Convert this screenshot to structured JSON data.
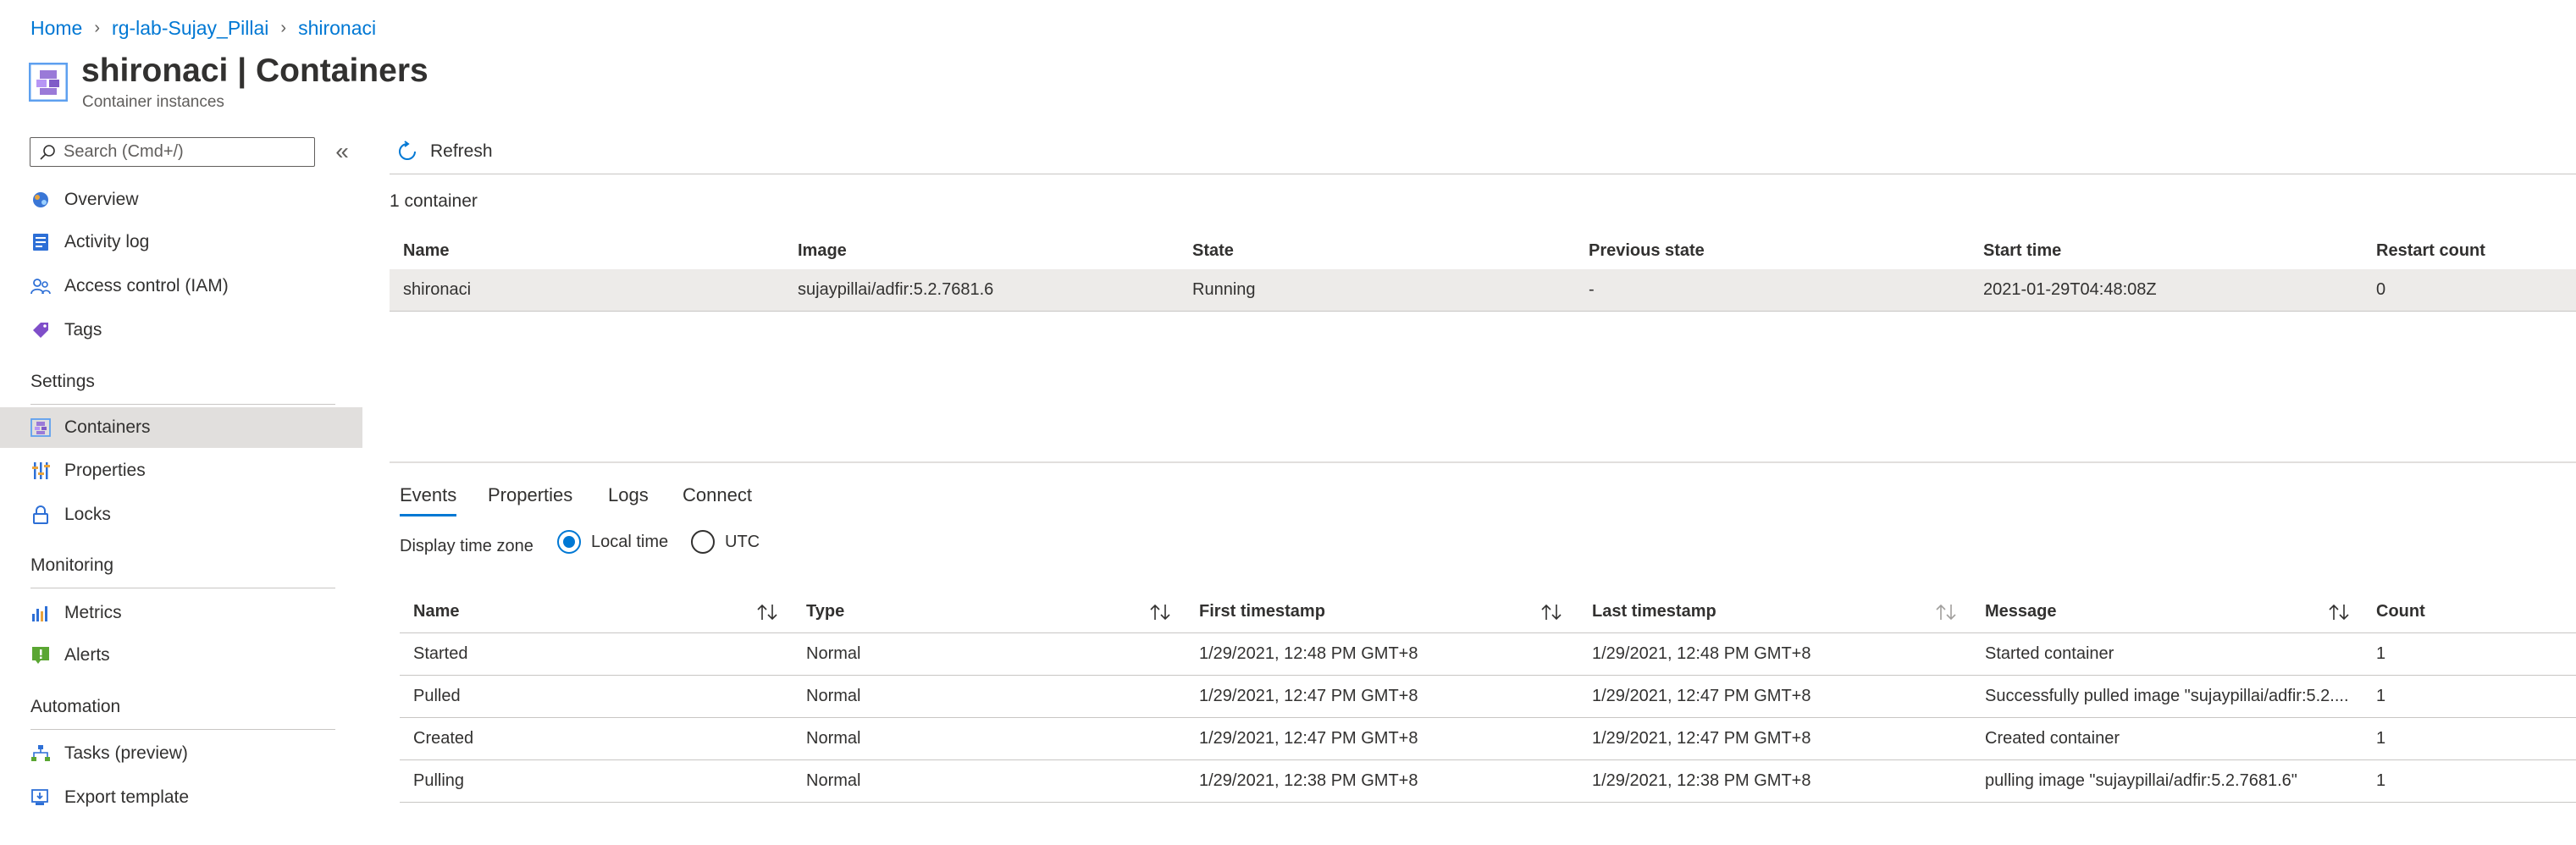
{
  "breadcrumb": {
    "home": "Home",
    "resource_group": "rg-lab-Sujay_Pillai",
    "resource": "shironaci"
  },
  "header": {
    "name": "shironaci",
    "separator": " | ",
    "section": "Containers",
    "subtitle": "Container instances"
  },
  "sidebar": {
    "search_placeholder": "Search (Cmd+/)",
    "collapse_glyph": "«",
    "items_top": [
      {
        "label": "Overview",
        "icon": "overview-icon"
      },
      {
        "label": "Activity log",
        "icon": "activity-log-icon"
      },
      {
        "label": "Access control (IAM)",
        "icon": "access-control-icon"
      },
      {
        "label": "Tags",
        "icon": "tag-icon"
      }
    ],
    "settings_header": "Settings",
    "settings_items": [
      {
        "label": "Containers",
        "icon": "containers-icon",
        "selected": true
      },
      {
        "label": "Properties",
        "icon": "properties-icon"
      },
      {
        "label": "Locks",
        "icon": "lock-icon"
      }
    ],
    "monitoring_header": "Monitoring",
    "monitoring_items": [
      {
        "label": "Metrics",
        "icon": "metrics-icon"
      },
      {
        "label": "Alerts",
        "icon": "alerts-icon"
      }
    ],
    "automation_header": "Automation",
    "automation_items": [
      {
        "label": "Tasks (preview)",
        "icon": "tasks-icon"
      },
      {
        "label": "Export template",
        "icon": "export-template-icon"
      }
    ]
  },
  "toolbar": {
    "refresh_label": "Refresh"
  },
  "containers": {
    "count_label": "1 container",
    "columns": [
      "Name",
      "Image",
      "State",
      "Previous state",
      "Start time",
      "Restart count"
    ],
    "rows": [
      {
        "name": "shironaci",
        "image": "sujaypillai/adfir:5.2.7681.6",
        "state": "Running",
        "previous_state": "-",
        "start_time": "2021-01-29T04:48:08Z",
        "restart_count": "0"
      }
    ]
  },
  "tabs": [
    "Events",
    "Properties",
    "Logs",
    "Connect"
  ],
  "timezone": {
    "label": "Display time zone",
    "options": [
      "Local time",
      "UTC"
    ],
    "selected": "Local time"
  },
  "events": {
    "columns": [
      "Name",
      "Type",
      "First timestamp",
      "Last timestamp",
      "Message",
      "Count"
    ],
    "rows": [
      {
        "name": "Started",
        "type": "Normal",
        "first": "1/29/2021, 12:48 PM GMT+8",
        "last": "1/29/2021, 12:48 PM GMT+8",
        "message": "Started container",
        "count": "1"
      },
      {
        "name": "Pulled",
        "type": "Normal",
        "first": "1/29/2021, 12:47 PM GMT+8",
        "last": "1/29/2021, 12:47 PM GMT+8",
        "message": "Successfully pulled image \"sujaypillai/adfir:5.2....",
        "count": "1"
      },
      {
        "name": "Created",
        "type": "Normal",
        "first": "1/29/2021, 12:47 PM GMT+8",
        "last": "1/29/2021, 12:47 PM GMT+8",
        "message": "Created container",
        "count": "1"
      },
      {
        "name": "Pulling",
        "type": "Normal",
        "first": "1/29/2021, 12:38 PM GMT+8",
        "last": "1/29/2021, 12:38 PM GMT+8",
        "message": "pulling image \"sujaypillai/adfir:5.2.7681.6\"",
        "count": "1"
      }
    ]
  },
  "colors": {
    "accent": "#0078d4",
    "selected_bg": "#e1dfdd",
    "row_bg": "#edebe9",
    "text": "#323130"
  }
}
